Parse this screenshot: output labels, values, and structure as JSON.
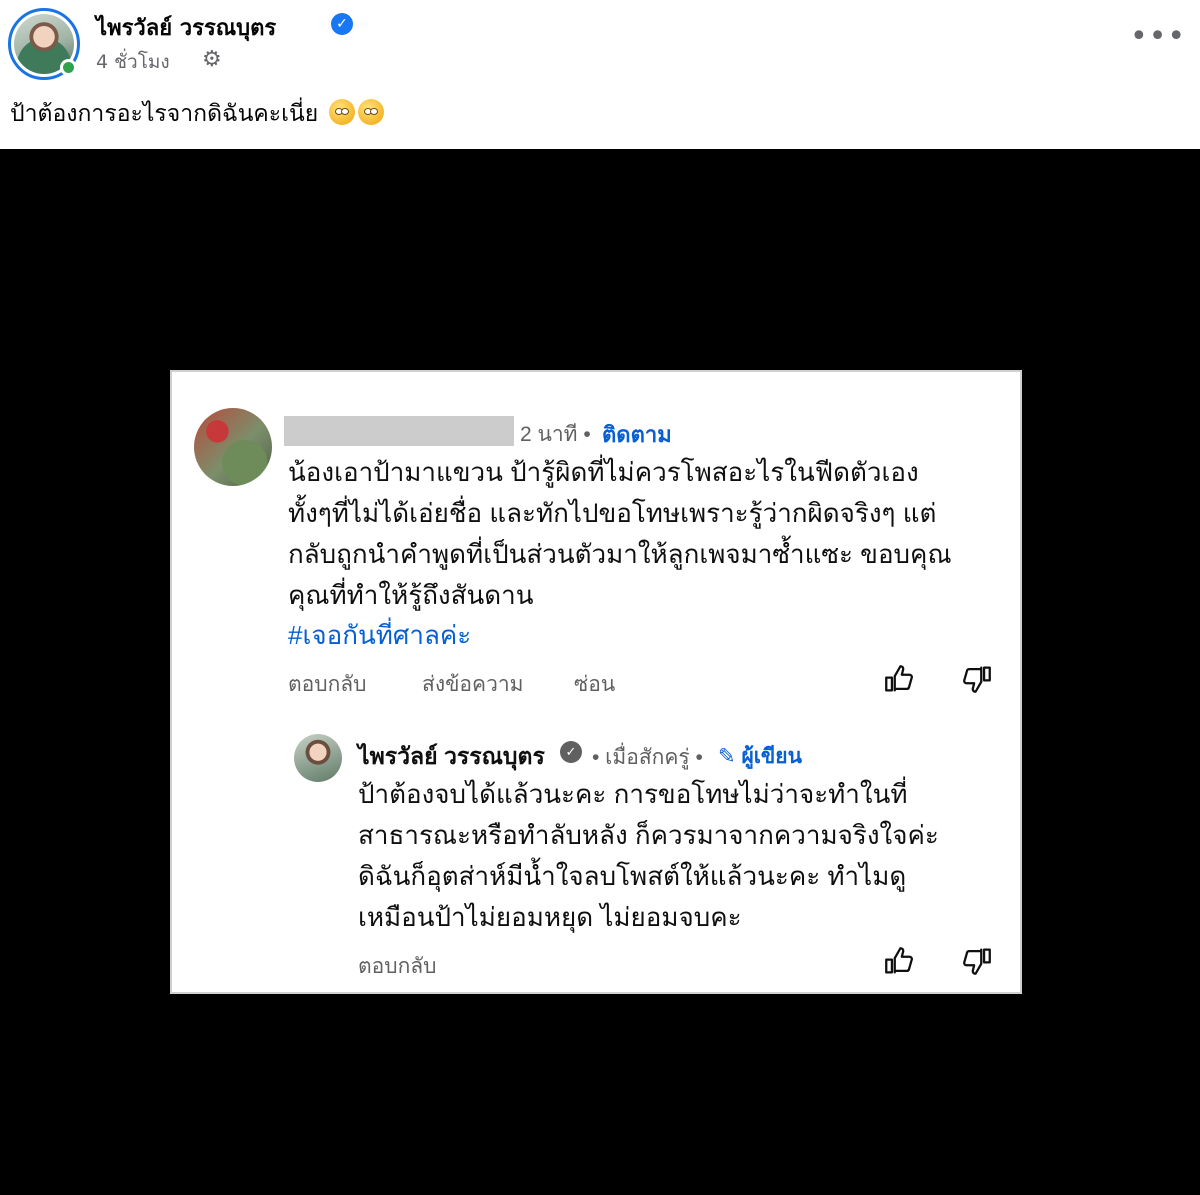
{
  "post": {
    "author_name": "ไพรวัลย์ วรรณบุตร",
    "time": "4 ชั่วโมง",
    "caption": "ป้าต้องการอะไรจากดิฉันคะเนี่ย",
    "icons": {
      "verified": "verified-badge-icon",
      "privacy": "gear-icon",
      "more": "more-options-icon",
      "emoji": "eye-roll-emoji"
    },
    "colors": {
      "accent": "#1877f2",
      "online": "#31a24c",
      "secondary_text": "#65676b"
    }
  },
  "embedded_screenshot": {
    "comment": {
      "time": "2 นาที",
      "separator": "•",
      "follow_label": "ติดตาม",
      "lines": [
        "น้องเอาป้ามาแขวน  ป้ารู้ผิดที่ไม่ควรโพสอะไรในฟีดตัวเอง",
        "ทั้งๆที่ไม่ได้เอ่ยชื่อ และทักไปขอโทษเพราะรู้ว่ากผิดจริงๆ แต่",
        "กลับถูกนำคำพูดที่เป็นส่วนตัวมาให้ลูกเพจมาซ้ำแซะ ขอบคุณ",
        "คุณที่ทำให้รู้ถึงสันดาน"
      ],
      "hashtag": "#เจอกันที่ศาลค่ะ",
      "actions": {
        "reply": "ตอบกลับ",
        "message": "ส่งข้อความ",
        "hide": "ซ่อน"
      }
    },
    "reply": {
      "author_name": "ไพรวัลย์ วรรณบุตร",
      "time": "• เมื่อสักครู่ •",
      "author_tag": "ผู้เขียน",
      "lines": [
        "ป้าต้องจบได้แล้วนะคะ  การขอโทษไม่ว่าจะทำในที่",
        "สาธารณะหรือทำลับหลัง  ก็ควรมาจากความจริงใจค่ะ",
        "ดิฉันก็อุตส่าห์มีน้ำใจลบโพสต์ให้แล้วนะคะ  ทำไมดู",
        "เหมือนป้าไม่ยอมหยุด ไม่ยอมจบคะ"
      ],
      "actions": {
        "reply": "ตอบกลับ"
      }
    },
    "icons": {
      "like": "thumbs-up-icon",
      "dislike": "thumbs-down-icon",
      "edit": "pencil-icon"
    },
    "colors": {
      "link": "#065fd4",
      "meta": "#606060"
    }
  }
}
